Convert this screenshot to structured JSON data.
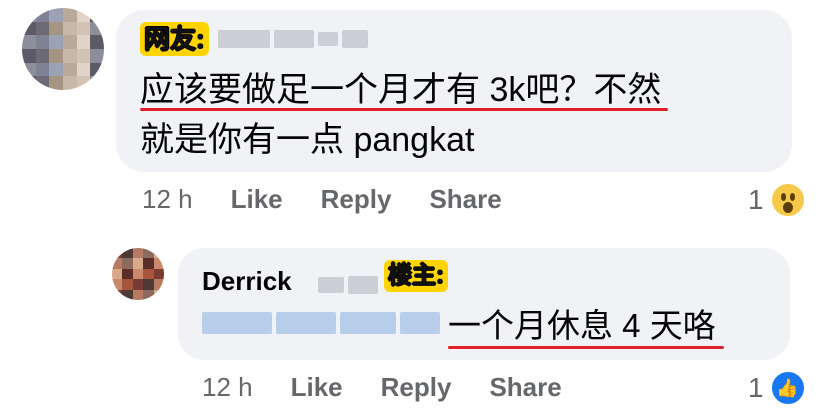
{
  "comment": {
    "tag": "网友:",
    "line1": "应该要做足一个月才有 3k吧？不然",
    "line2": "就是你有一点 pangkat",
    "time": "12 h",
    "like_label": "Like",
    "reply_label": "Reply",
    "share_label": "Share",
    "reaction_count": "1",
    "reaction_icon": "wow-reaction-icon"
  },
  "reply": {
    "name": "Derrick",
    "tag": "楼主:",
    "text": "一个月休息 4 天咯",
    "time": "12 h",
    "like_label": "Like",
    "reply_label": "Reply",
    "share_label": "Share",
    "reaction_count": "1",
    "reaction_icon": "like-reaction-icon"
  },
  "colors": {
    "bubble": "#f0f2f5",
    "tag_yellow": "#ffd400",
    "underline_red": "#e0202a",
    "meta_gray": "#65676b",
    "like_blue": "#1877f2"
  }
}
